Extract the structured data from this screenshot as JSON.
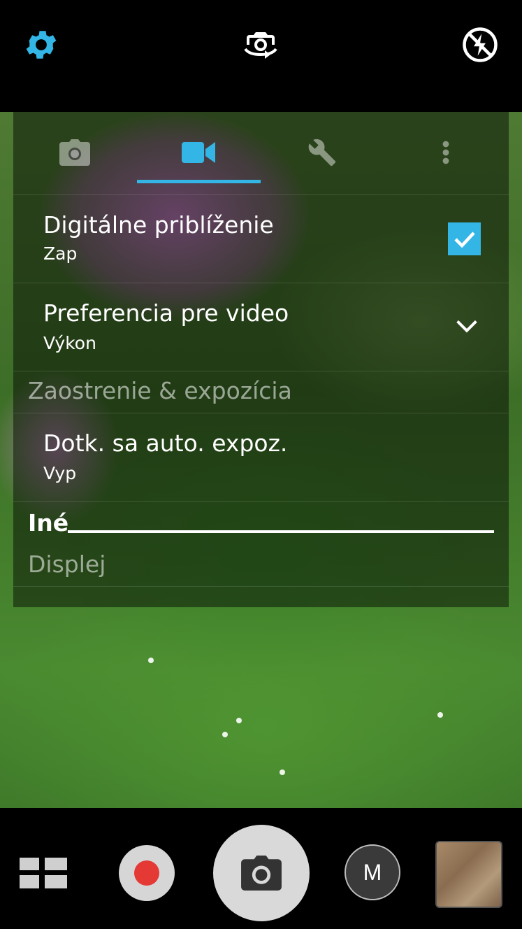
{
  "top_bar": {
    "settings_icon": "gear-icon",
    "switch_camera_icon": "switch-camera-icon",
    "flash_icon": "flash-off-icon",
    "accent_color": "#33b5e5"
  },
  "tabs": [
    {
      "name": "camera-tab",
      "icon": "camera-icon",
      "active": false
    },
    {
      "name": "video-tab",
      "icon": "video-camera-icon",
      "active": true
    },
    {
      "name": "tools-tab",
      "icon": "wrench-icon",
      "active": false
    },
    {
      "name": "more-tab",
      "icon": "more-vertical-icon",
      "active": false
    }
  ],
  "settings": {
    "digital_zoom": {
      "title": "Digitálne priblíženie",
      "value": "Zap",
      "checked": true
    },
    "video_preference": {
      "title": "Preferencia pre video",
      "value": "Výkon"
    },
    "focus_section": "Zaostrenie & expozícia",
    "touch_exposure": {
      "title": "Dotk. sa auto. expoz.",
      "value": "Vyp"
    },
    "other_section": "Iné",
    "display_section": "Displej"
  },
  "bottom_bar": {
    "grid_icon": "modes-grid-icon",
    "record_icon": "record-icon",
    "shutter_icon": "camera-icon",
    "manual_label": "M",
    "record_color": "#e53935"
  }
}
